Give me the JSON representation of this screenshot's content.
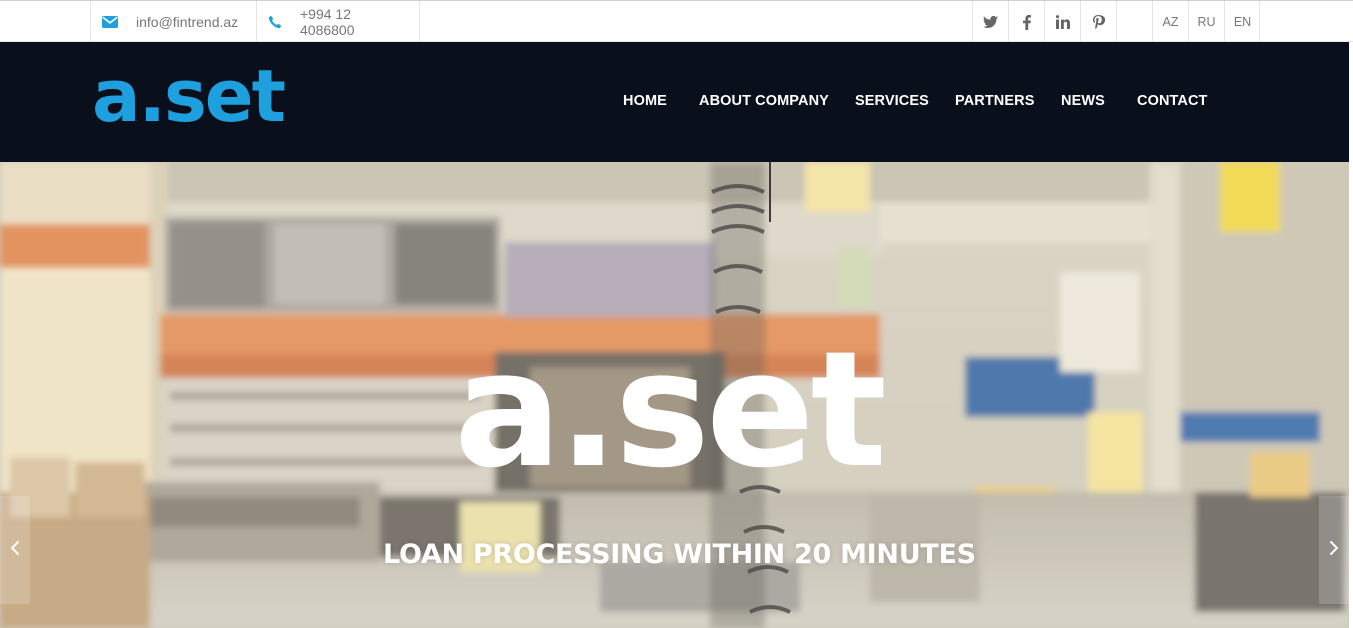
{
  "topbar": {
    "email": "info@fintrend.az",
    "phone": "+994 12 4086800",
    "email_icon": "envelope-icon",
    "phone_icon": "phone-icon",
    "social": [
      {
        "name": "twitter",
        "icon": "twitter-icon"
      },
      {
        "name": "facebook",
        "icon": "facebook-icon"
      },
      {
        "name": "linkedin",
        "icon": "linkedin-icon"
      },
      {
        "name": "pinterest",
        "icon": "pinterest-icon"
      }
    ],
    "languages": [
      "AZ",
      "RU",
      "EN"
    ]
  },
  "header": {
    "logo": "a.set",
    "nav": [
      "HOME",
      "ABOUT COMPANY",
      "SERVICES",
      "PARTNERS",
      "NEWS",
      "CONTACT"
    ]
  },
  "hero": {
    "title": "a.set",
    "subtitle": "LOAN PROCESSING WITHIN 20 MINUTES",
    "prev_icon": "chevron-left-icon",
    "next_icon": "chevron-right-icon"
  },
  "colors": {
    "brand": "#1ea0de",
    "header_bg": "#0a0f1c",
    "topbar_text": "#777777",
    "icon_blue": "#1ea0de",
    "social_icon": "#666666"
  }
}
